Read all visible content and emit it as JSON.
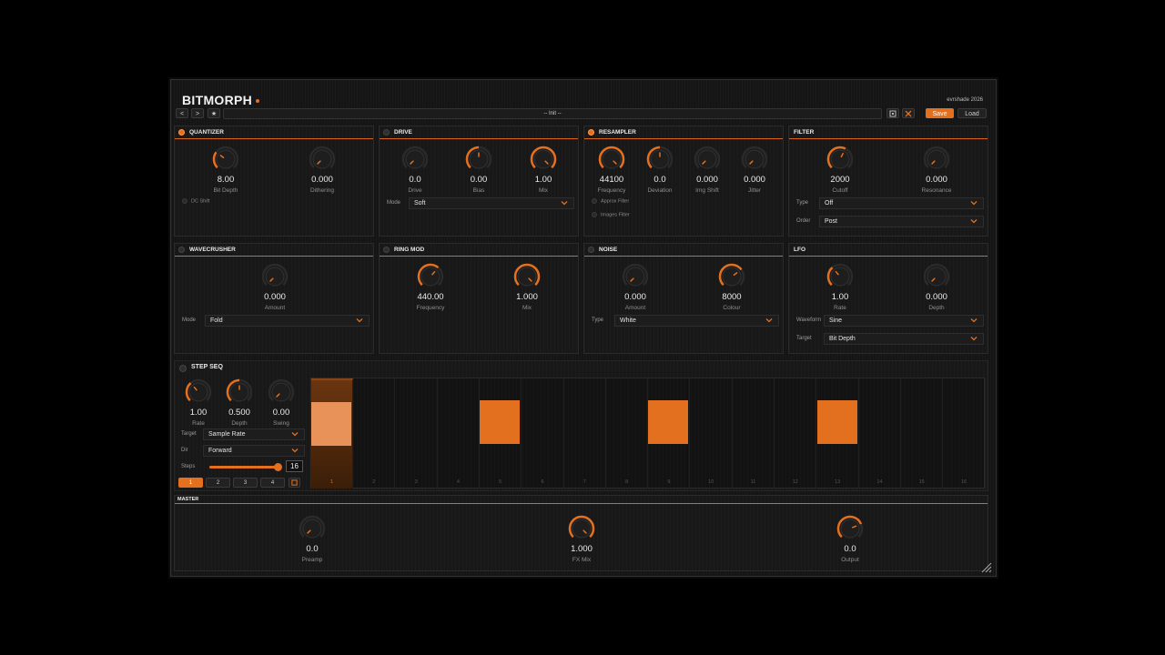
{
  "header": {
    "logo": "BITMORPH",
    "vendor": "evrshade 2026",
    "prev": "<",
    "next": ">",
    "fav": "★",
    "preset": "-- Init --",
    "save": "Save",
    "load": "Load"
  },
  "colors": {
    "accent": "#e2701f",
    "panel": "#181818",
    "bg": "#000000"
  },
  "quantizer": {
    "title": "QUANTIZER",
    "enabled": true,
    "knobs": [
      {
        "value": "8.00",
        "label": "Bit Depth",
        "level": 0.3
      },
      {
        "value": "0.000",
        "label": "Dithering",
        "level": 0
      }
    ],
    "toggle": "DC Shift"
  },
  "drive": {
    "title": "DRIVE",
    "enabled": false,
    "knobs": [
      {
        "value": "0.0",
        "label": "Drive",
        "level": 0
      },
      {
        "value": "0.00",
        "label": "Bias",
        "level": 0.5
      },
      {
        "value": "1.00",
        "label": "Mix",
        "level": 1
      }
    ],
    "mode_label": "Mode",
    "mode": "Soft"
  },
  "resampler": {
    "title": "RESAMPLER",
    "enabled": true,
    "knobs": [
      {
        "value": "44100",
        "label": "Frequency",
        "level": 1
      },
      {
        "value": "0.0",
        "label": "Deviation",
        "level": 0.5
      },
      {
        "value": "0.000",
        "label": "Img Shift",
        "level": 0
      },
      {
        "value": "0.000",
        "label": "Jitter",
        "level": 0
      }
    ],
    "toggles": [
      "Approx Filter",
      "Images Filter"
    ]
  },
  "filter": {
    "title": "FILTER",
    "enabled": false,
    "knobs": [
      {
        "value": "2000",
        "label": "Cutoff",
        "level": 0.6
      },
      {
        "value": "0.000",
        "label": "Resonance",
        "level": 0
      }
    ],
    "type_label": "Type",
    "type": "Off",
    "order_label": "Order",
    "order": "Post"
  },
  "wavecrusher": {
    "title": "WAVECRUSHER",
    "enabled": false,
    "knobs": [
      {
        "value": "0.000",
        "label": "Amount",
        "level": 0
      }
    ],
    "mode_label": "Mode",
    "mode": "Fold"
  },
  "ringmod": {
    "title": "RING MOD",
    "enabled": false,
    "knobs": [
      {
        "value": "440.00",
        "label": "Frequency",
        "level": 0.65
      },
      {
        "value": "1.000",
        "label": "Mix",
        "level": 1
      }
    ]
  },
  "noise": {
    "title": "NOISE",
    "enabled": false,
    "knobs": [
      {
        "value": "0.000",
        "label": "Amount",
        "level": 0
      },
      {
        "value": "8000",
        "label": "Colour",
        "level": 0.7
      }
    ],
    "type_label": "Type",
    "type": "White"
  },
  "lfo": {
    "title": "LFO",
    "enabled": false,
    "knobs": [
      {
        "value": "1.00",
        "label": "Rate",
        "level": 0.35
      },
      {
        "value": "0.000",
        "label": "Depth",
        "level": 0
      }
    ],
    "waveform_label": "Waveform",
    "waveform": "Sine",
    "target_label": "Target",
    "target": "Bit Depth"
  },
  "stepseq": {
    "title": "STEP SEQ",
    "enabled": false,
    "knobs": [
      {
        "value": "1.00",
        "label": "Rate",
        "level": 0.35
      },
      {
        "value": "0.500",
        "label": "Depth",
        "level": 0.5
      },
      {
        "value": "0.00",
        "label": "Swing",
        "level": 0
      }
    ],
    "target_label": "Target",
    "target": "Sample Rate",
    "dir_label": "Dir",
    "dir": "Forward",
    "steps_label": "Steps",
    "steps": "16",
    "steps_fraction": 0.96,
    "pages": [
      "1",
      "2",
      "3",
      "4"
    ],
    "active_page": 0,
    "step_numbers": [
      "1",
      "2",
      "3",
      "4",
      "5",
      "6",
      "7",
      "8",
      "9",
      "10",
      "11",
      "12",
      "13",
      "14",
      "15",
      "16"
    ],
    "step_values": [
      0.4,
      0,
      0,
      0,
      0.4,
      0,
      0,
      0,
      0.4,
      0,
      0,
      0,
      0.4,
      0,
      0,
      0
    ],
    "current_step": 0
  },
  "master": {
    "title": "MASTER",
    "knobs": [
      {
        "value": "0.0",
        "label": "Preamp",
        "level": 0
      },
      {
        "value": "1.000",
        "label": "FX Mix",
        "level": 1
      },
      {
        "value": "0.0",
        "label": "Output",
        "level": 0.75
      }
    ]
  }
}
